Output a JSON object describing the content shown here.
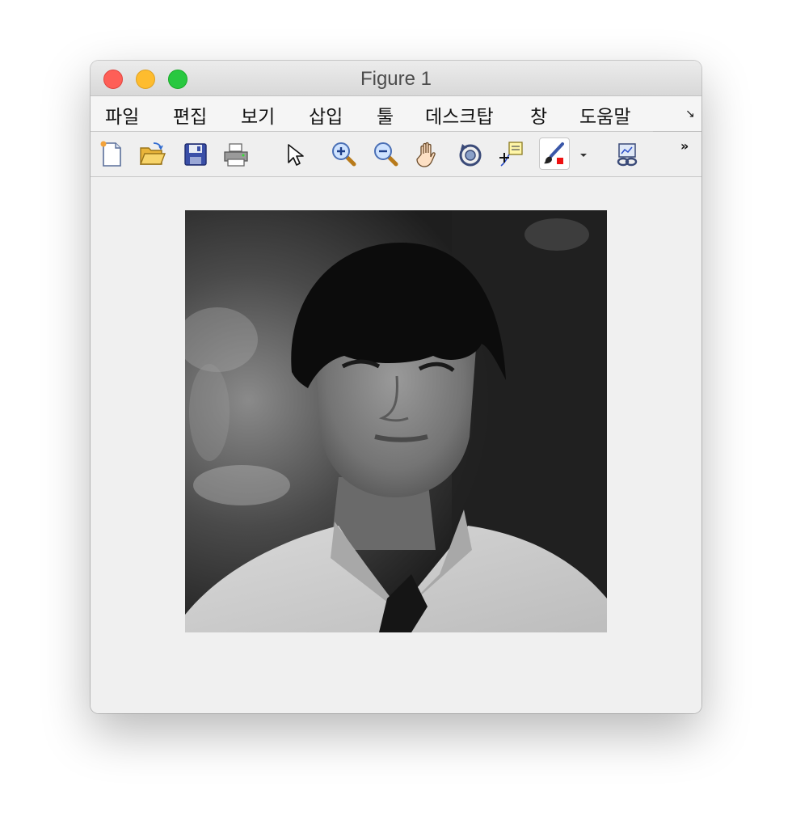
{
  "window": {
    "title": "Figure 1",
    "traffic_lights": {
      "close": "#fe5f57",
      "minimize": "#febc2e",
      "maximize": "#28c840"
    }
  },
  "menu": {
    "items": [
      "파일",
      "편집",
      "보기",
      "삽입",
      "툴",
      "데스크탑",
      "창",
      "도움말"
    ],
    "corner_icon": "dock-arrow-icon"
  },
  "toolbar": {
    "buttons": [
      {
        "icon": "new-figure-icon"
      },
      {
        "icon": "open-file-icon"
      },
      {
        "icon": "save-icon"
      },
      {
        "icon": "print-icon"
      },
      {
        "icon": "pointer-icon"
      },
      {
        "icon": "zoom-in-icon"
      },
      {
        "icon": "zoom-out-icon"
      },
      {
        "icon": "pan-hand-icon"
      },
      {
        "icon": "rotate-3d-icon"
      },
      {
        "icon": "data-cursor-icon"
      },
      {
        "icon": "brush-icon",
        "selected": true
      },
      {
        "icon": "dropdown-arrow-icon"
      },
      {
        "icon": "link-plot-icon"
      }
    ],
    "overflow_icon": "chevron-double-right-icon"
  },
  "axes": {
    "image": "grayscale-portrait-image"
  }
}
